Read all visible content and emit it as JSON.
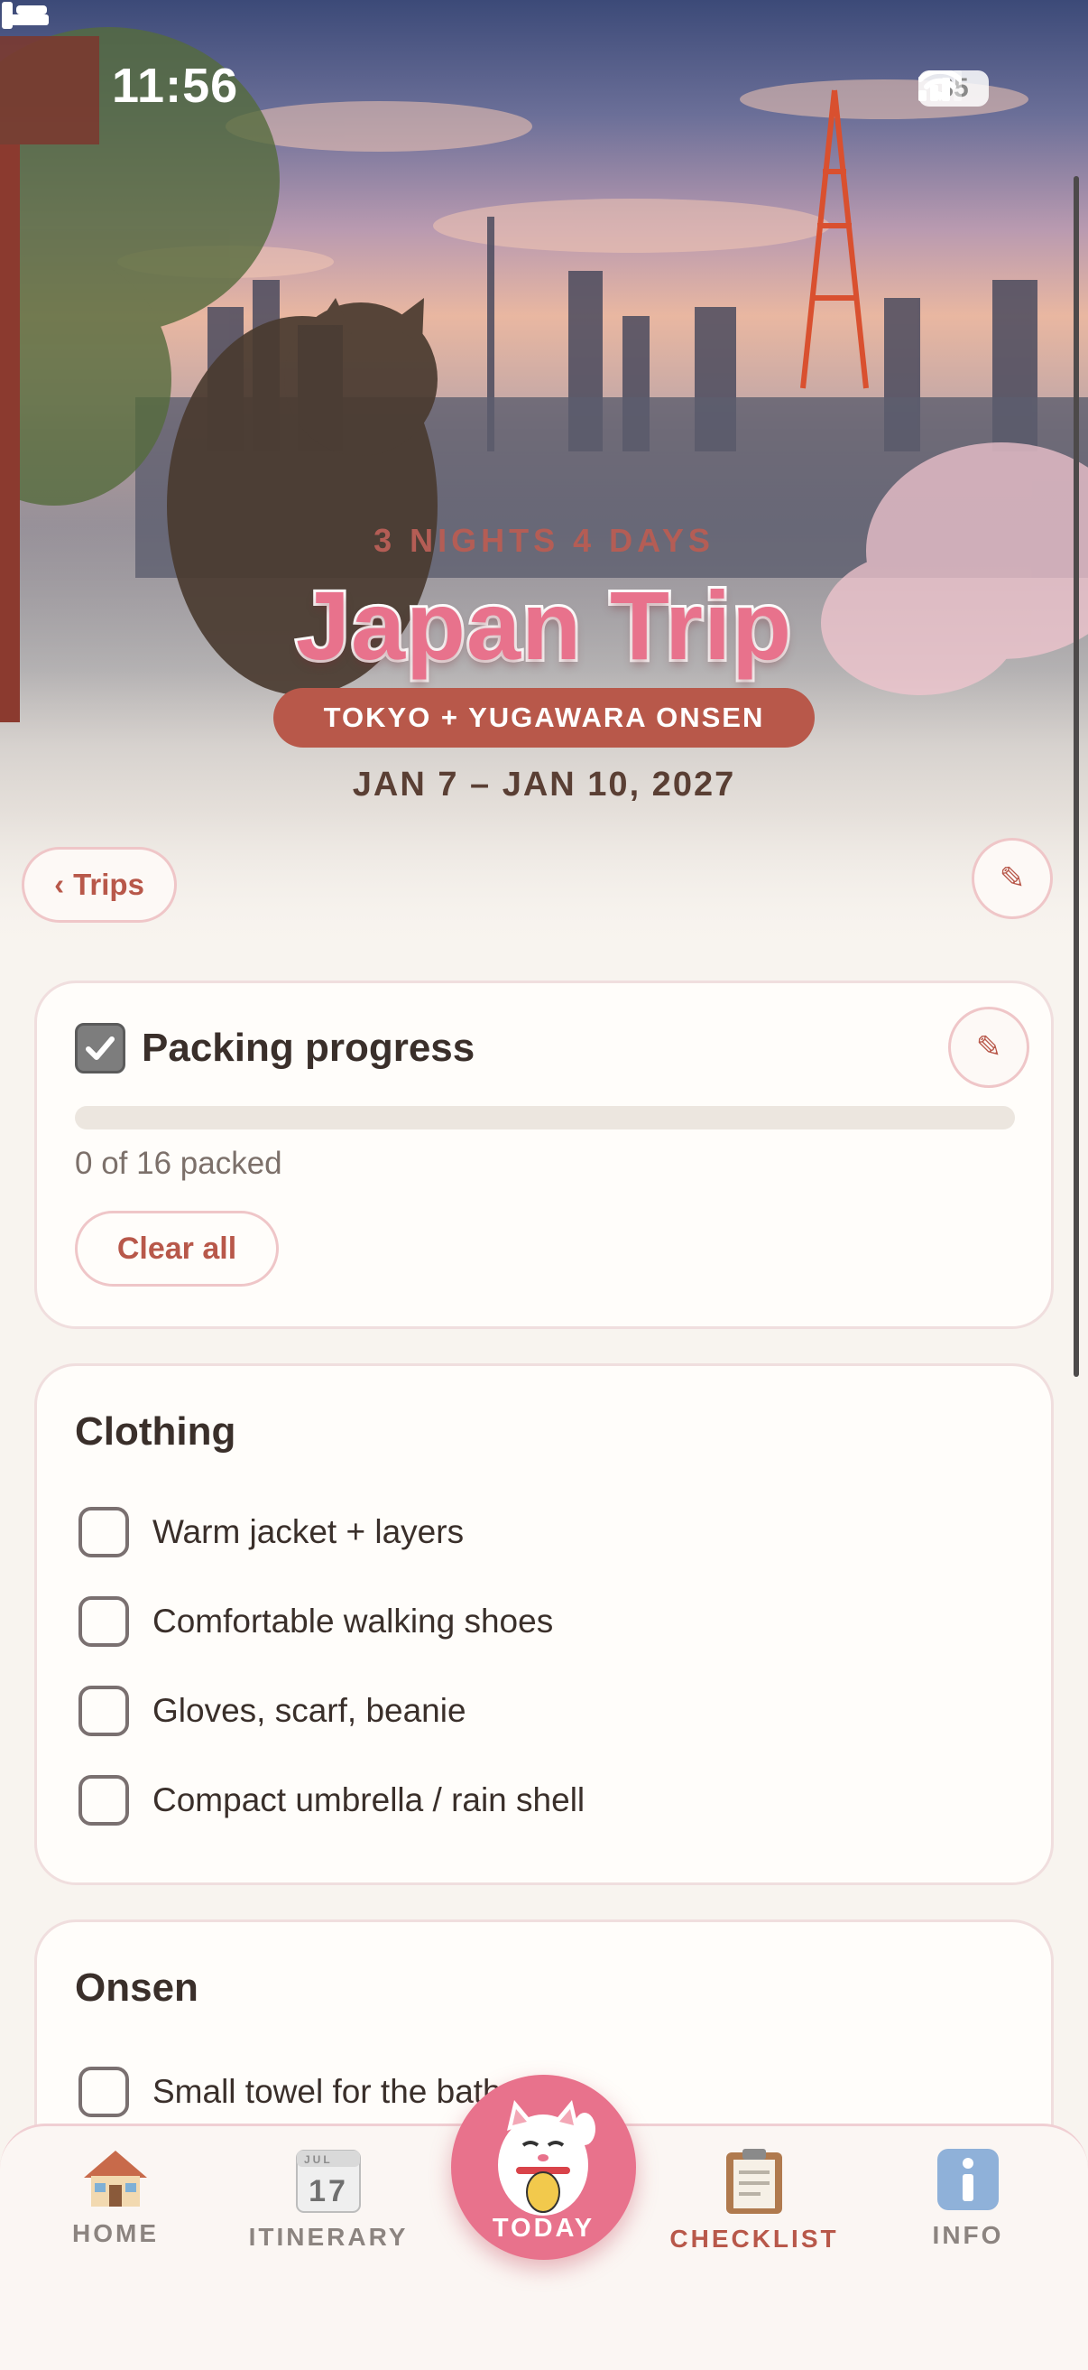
{
  "status_bar": {
    "time": "11:56",
    "battery": "35"
  },
  "hero": {
    "subtitle": "3 NIGHTS 4 DAYS",
    "title": "Japan Trip",
    "destinations": "TOKYO + YUGAWARA ONSEN",
    "dates": "JAN 7 – JAN 10, 2027"
  },
  "nav": {
    "back_label": "Trips",
    "back_chevron": "‹",
    "edit_icon": "pencil-icon"
  },
  "progress_card": {
    "title": "Packing progress",
    "packed": 0,
    "total": 16,
    "count_text": "0 of 16 packed",
    "clear_label": "Clear all",
    "fill_fraction": 0
  },
  "categories": [
    {
      "title": "Clothing",
      "items": [
        {
          "label": "Warm jacket + layers",
          "checked": false
        },
        {
          "label": "Comfortable walking shoes",
          "checked": false
        },
        {
          "label": "Gloves, scarf, beanie",
          "checked": false
        },
        {
          "label": "Compact umbrella / rain shell",
          "checked": false
        }
      ]
    },
    {
      "title": "Onsen",
      "items": [
        {
          "label": "Small towel for the bath",
          "checked": false
        }
      ]
    }
  ],
  "tabs": [
    {
      "label": "HOME",
      "icon": "house-icon"
    },
    {
      "label": "ITINERARY",
      "icon": "calendar-icon",
      "icon_month": "JUL",
      "icon_day": "17"
    },
    {
      "label": "TODAY",
      "icon": "lucky-cat-icon",
      "active_highlight": true
    },
    {
      "label": "CHECKLIST",
      "icon": "clipboard-icon",
      "selected": true
    },
    {
      "label": "INFO",
      "icon": "info-icon"
    }
  ],
  "colors": {
    "accent": "#b8584a",
    "pink": "#e8728c",
    "background": "#f8f4ef",
    "card_border": "#f0dede"
  }
}
